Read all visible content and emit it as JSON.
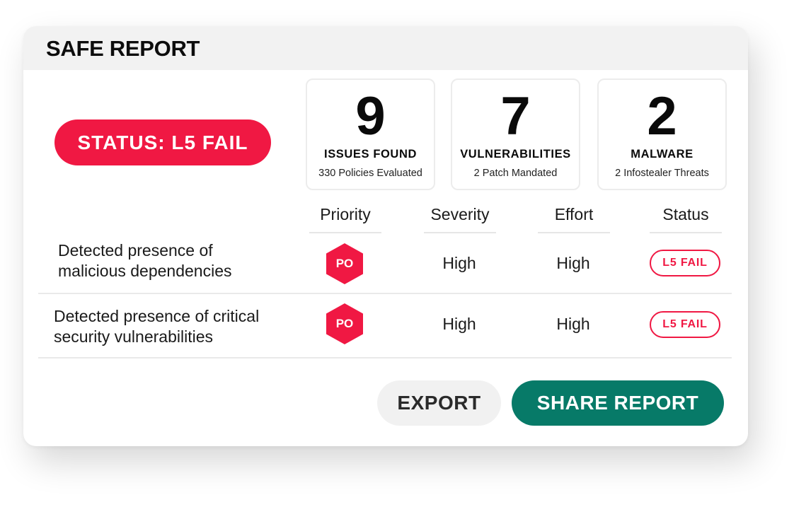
{
  "report": {
    "title": "SAFE REPORT",
    "status_label": "STATUS: L5 FAIL"
  },
  "stats": [
    {
      "value": "9",
      "label": "ISSUES FOUND",
      "sub": "330 Policies Evaluated"
    },
    {
      "value": "7",
      "label": "VULNERABILITIES",
      "sub": "2 Patch Mandated"
    },
    {
      "value": "2",
      "label": "MALWARE",
      "sub": "2 Infostealer Threats"
    }
  ],
  "table": {
    "columns": [
      "Priority",
      "Severity",
      "Effort",
      "Status"
    ],
    "rows": [
      {
        "description_line1": "Detected presence of",
        "description_line2": "malicious dependencies",
        "priority": "PO",
        "severity": "High",
        "effort": "High",
        "status": "L5 FAIL"
      },
      {
        "description_line1": "Detected presence of critical",
        "description_line2": "security vulnerabilities",
        "priority": "PO",
        "severity": "High",
        "effort": "High",
        "status": "L5 FAIL"
      }
    ]
  },
  "actions": {
    "export_label": "EXPORT",
    "share_label": "SHARE REPORT"
  },
  "colors": {
    "accent_red": "#f01843",
    "share_green": "#077a68",
    "header_gray": "#f2f2f2"
  }
}
